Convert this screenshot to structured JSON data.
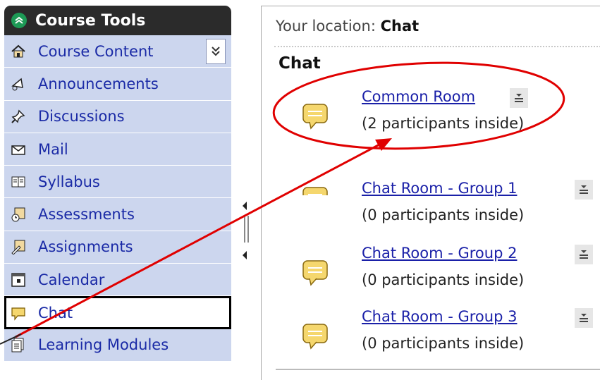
{
  "sidebar": {
    "header": "Course Tools",
    "items": [
      {
        "label": "Course Content",
        "icon": "home-icon"
      },
      {
        "label": "Announcements",
        "icon": "megaphone-icon"
      },
      {
        "label": "Discussions",
        "icon": "pushpin-icon"
      },
      {
        "label": "Mail",
        "icon": "envelope-icon"
      },
      {
        "label": "Syllabus",
        "icon": "book-icon"
      },
      {
        "label": "Assessments",
        "icon": "assessment-icon"
      },
      {
        "label": "Assignments",
        "icon": "assignment-icon"
      },
      {
        "label": "Calendar",
        "icon": "calendar-icon"
      },
      {
        "label": "Chat",
        "icon": "chat-icon"
      },
      {
        "label": "Learning Modules",
        "icon": "modules-icon"
      }
    ]
  },
  "main": {
    "location_label": "Your location:",
    "location_value": "Chat",
    "title": "Chat",
    "rooms": [
      {
        "name": "Common Room",
        "count": "(2 participants inside)"
      },
      {
        "name": "Chat Room - Group 1",
        "count": "(0 participants inside)"
      },
      {
        "name": "Chat Room - Group 2",
        "count": "(0 participants inside)"
      },
      {
        "name": "Chat Room - Group 3",
        "count": "(0 participants inside)"
      }
    ]
  },
  "colors": {
    "sidebar_bg": "#ccd6ee",
    "link": "#1a20a8",
    "header_bg": "#2b2b2b",
    "annotation": "#e00000"
  }
}
